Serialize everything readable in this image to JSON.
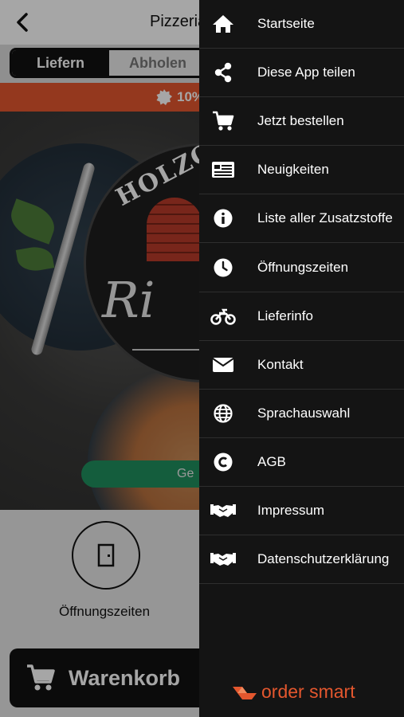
{
  "header": {
    "title": "Pizzeria"
  },
  "order_mode": {
    "options": [
      "Liefern",
      "Abholen"
    ],
    "selected": "Liefern"
  },
  "promo": {
    "text": "10%"
  },
  "hero": {
    "logo_text": "HOLZOFE",
    "logo_script": "Ri",
    "geo_button_label": "Ge"
  },
  "shortcuts": {
    "hours_label": "Öffnungszeiten"
  },
  "cart": {
    "label": "Warenkorb"
  },
  "drawer": {
    "items": [
      {
        "label": "Startseite",
        "icon": "home-icon"
      },
      {
        "label": "Diese App teilen",
        "icon": "share-icon"
      },
      {
        "label": "Jetzt bestellen",
        "icon": "cart-icon"
      },
      {
        "label": "Neuigkeiten",
        "icon": "news-icon"
      },
      {
        "label": "Liste aller Zusatzstoffe",
        "icon": "info-icon"
      },
      {
        "label": "Öffnungszeiten",
        "icon": "clock-icon"
      },
      {
        "label": "Lieferinfo",
        "icon": "motorbike-icon"
      },
      {
        "label": "Kontakt",
        "icon": "envelope-icon"
      },
      {
        "label": "Sprachauswahl",
        "icon": "globe-icon"
      },
      {
        "label": "AGB",
        "icon": "copyright-icon"
      },
      {
        "label": "Impressum",
        "icon": "handshake-icon"
      },
      {
        "label": "Datenschutzerklärung",
        "icon": "handshake-icon"
      }
    ],
    "brand": "order smart"
  },
  "colors": {
    "accent": "#e4572e",
    "drawer_bg": "#141414",
    "geo_button": "#1f8f5e"
  }
}
